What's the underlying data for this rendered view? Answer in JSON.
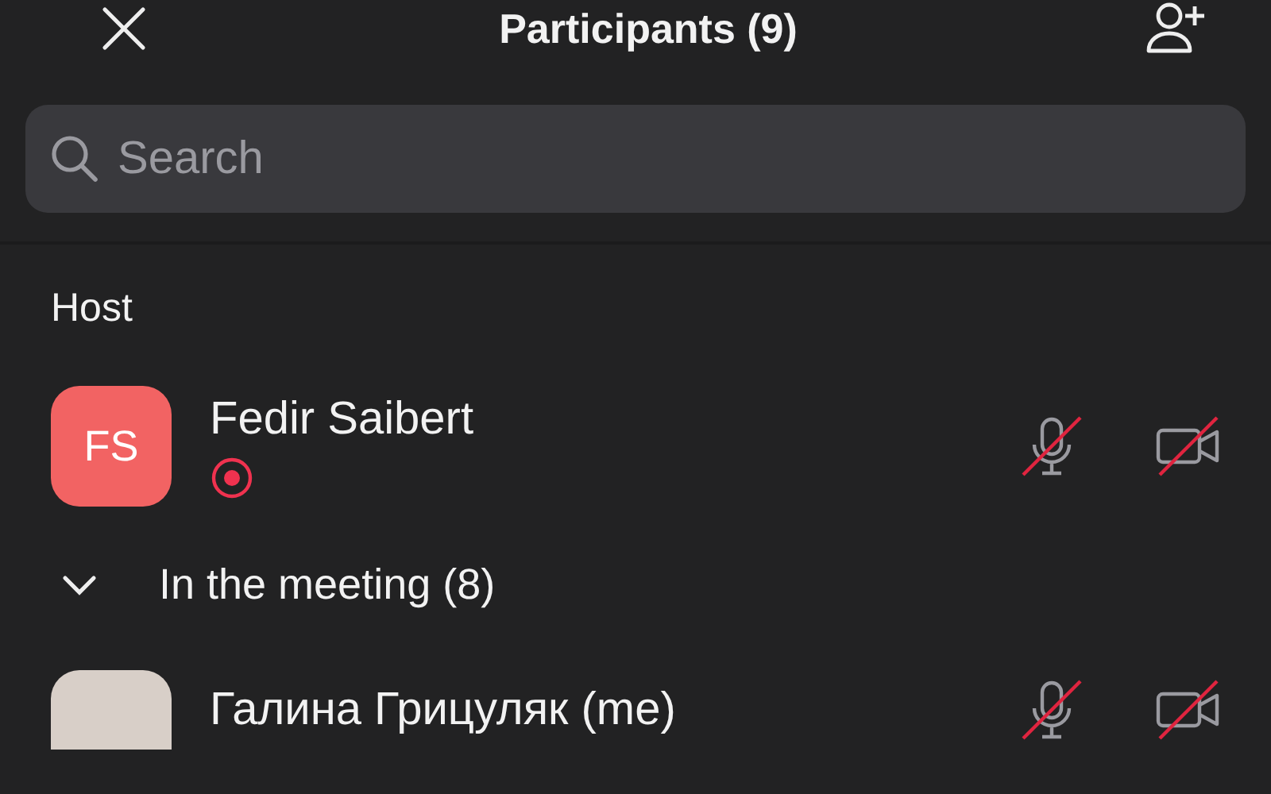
{
  "header": {
    "title": "Participants (9)"
  },
  "search": {
    "placeholder": "Search"
  },
  "host_section": {
    "label": "Host",
    "participants": [
      {
        "name": "Fedir Saibert",
        "initials": "FS",
        "kind": "initials",
        "recording": true,
        "mic_muted": true,
        "video_off": true
      }
    ]
  },
  "meeting_section": {
    "label": "In the meeting (8)",
    "expanded": true,
    "participants": [
      {
        "name": "Галина Грицуляк (me)",
        "kind": "photo",
        "recording": false,
        "mic_muted": true,
        "video_off": true
      }
    ]
  }
}
